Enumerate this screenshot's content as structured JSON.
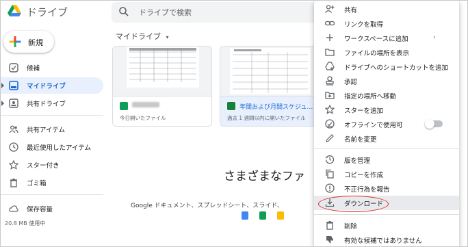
{
  "header": {
    "app_title": "ドライブ",
    "search_placeholder": "ドライブで検索"
  },
  "sidebar": {
    "new_label": "新規",
    "items": [
      {
        "label": "候補",
        "icon": "check-circle-icon"
      },
      {
        "label": "マイドライブ",
        "icon": "my-drive-icon",
        "active": true
      },
      {
        "label": "共有ドライブ",
        "icon": "shared-drive-icon"
      },
      {
        "label": "共有アイテム",
        "icon": "people-icon"
      },
      {
        "label": "最近使用したアイテム",
        "icon": "clock-icon"
      },
      {
        "label": "スター付き",
        "icon": "star-icon"
      },
      {
        "label": "ゴミ箱",
        "icon": "trash-icon"
      },
      {
        "label": "保存容量",
        "icon": "cloud-icon"
      }
    ],
    "storage_used": "20.8 MB 使用中"
  },
  "main": {
    "title": "マイドライブ",
    "cards": [
      {
        "name": "",
        "meta": "今日開いたファイル",
        "icon_color": "#0f9d58"
      },
      {
        "name": "年間および月間スケジュ…",
        "meta": "過去 1 週間以内に開いたファイル",
        "icon_color": "#188038"
      }
    ],
    "empty_title": "さまざまなファ",
    "empty_sub": "Google ドキュメント、スプレッドシート、スライド、"
  },
  "context_menu": {
    "items": [
      {
        "label": "共有",
        "icon": "person-add-icon"
      },
      {
        "label": "リンクを取得",
        "icon": "link-icon"
      },
      {
        "label": "ワークスペースに追加",
        "icon": "plus-icon",
        "submenu": true
      },
      {
        "label": "ファイルの場所を表示",
        "icon": "folder-icon"
      },
      {
        "label": "ドライブへのショートカットを追加",
        "icon": "shortcut-icon"
      },
      {
        "label": "承認",
        "icon": "approval-icon"
      },
      {
        "label": "指定の場所へ移動",
        "icon": "move-icon"
      },
      {
        "label": "スターを追加",
        "icon": "star-outline-icon"
      },
      {
        "label": "オフラインで使用可",
        "icon": "offline-icon",
        "toggle": false
      },
      {
        "label": "名前を変更",
        "icon": "pencil-icon"
      },
      {
        "label": "版を管理",
        "icon": "history-icon"
      },
      {
        "label": "コピーを作成",
        "icon": "copy-icon"
      },
      {
        "label": "不正行為を報告",
        "icon": "report-icon"
      },
      {
        "label": "ダウンロード",
        "icon": "download-icon",
        "highlighted": true
      },
      {
        "label": "削除",
        "icon": "trash-icon"
      },
      {
        "label": "有効な候補ではありません",
        "icon": "thumbs-down-icon"
      }
    ]
  },
  "colors": {
    "accent_blue": "#1967d2",
    "active_bg": "#e8f0fe",
    "highlight_ring": "#d93025"
  }
}
